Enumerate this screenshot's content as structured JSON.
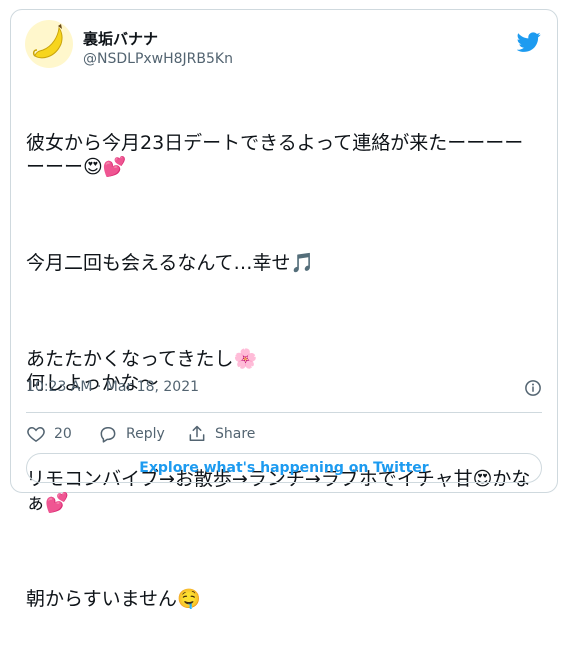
{
  "colors": {
    "twitter_blue": "#1d9bf0",
    "text_primary": "#0f1419",
    "text_secondary": "#536471",
    "border": "#cfd9de"
  },
  "header": {
    "display_name": "裏垢バナナ",
    "handle": "@NSDLPxwH8JRB5Kn",
    "avatar_icon": "banana-icon",
    "brand_icon": "twitter-bird-icon"
  },
  "tweet": {
    "paragraphs": [
      "彼女から今月23日デートできるよって連絡が来たーーーーーーー😍💕",
      "今月二回も会えるなんて…幸せ🎵",
      "あたたかくなってきたし🌸\n何しよっかな〜",
      "リモコンバイブ→お散歩→ランチ→ラブホでイチャ甘😍かなぁ💕",
      "朝からすいません🤤"
    ]
  },
  "meta": {
    "timestamp": "10:23 AM · Mar 18, 2021",
    "info_icon": "info-icon"
  },
  "actions": {
    "like_count": "20",
    "reply_label": "Reply",
    "share_label": "Share"
  },
  "footer": {
    "explore_label": "Explore what's happening on Twitter"
  }
}
